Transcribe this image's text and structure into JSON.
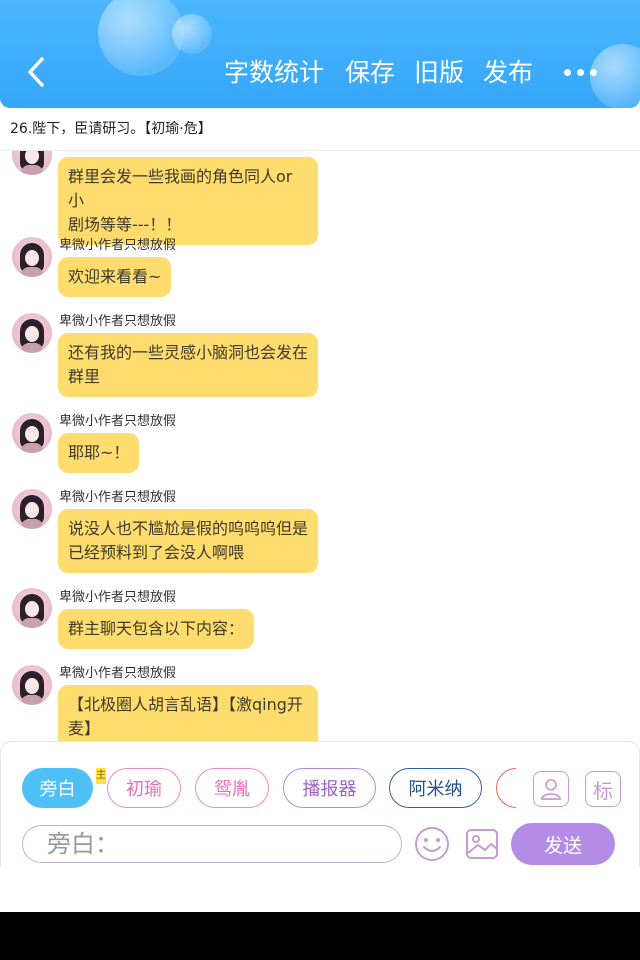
{
  "header": {
    "back_label": "<",
    "actions": [
      "字数统计",
      "保存",
      "旧版",
      "发布"
    ],
    "more_label": "•••",
    "colors": {
      "background": "#3aa9fa",
      "text": "#ffffff"
    }
  },
  "chapter": {
    "title": "26.陛下，臣请研习。【初瑜·危】"
  },
  "messages": [
    {
      "user": "",
      "lines": [
        "群里会发一些我画的角色同人or小",
        "剧场等等---！！"
      ]
    },
    {
      "user": "卑微小作者只想放假",
      "lines": [
        "欢迎来看看~"
      ]
    },
    {
      "user": "卑微小作者只想放假",
      "lines": [
        "还有我的一些灵感小脑洞也会发在",
        "群里"
      ]
    },
    {
      "user": "卑微小作者只想放假",
      "lines": [
        "耶耶~！"
      ]
    },
    {
      "user": "卑微小作者只想放假",
      "lines": [
        "说没人也不尴尬是假的呜呜呜但是",
        "已经预料到了会没人啊喂"
      ]
    },
    {
      "user": "卑微小作者只想放假",
      "lines": [
        "群主聊天包含以下内容："
      ]
    },
    {
      "user": "卑微小作者只想放假",
      "lines": [
        "【北极圈人胡言乱语】【激qing开",
        "麦】"
      ]
    }
  ],
  "composer": {
    "role_chips": [
      "旁白",
      "初瑜",
      "鸳胤",
      "播报器",
      "阿米纳"
    ],
    "chip_badge": "主",
    "side_buttons": {
      "portrait_icon": "portrait-icon",
      "tag_label": "标"
    },
    "input_placeholder": "旁白：",
    "emoji_icon": "emoji-icon",
    "image_icon": "image-icon",
    "send_label": "发送",
    "colors": {
      "narrator_chip": "#4dc0f5",
      "send_button": "#b48ce6",
      "bubble": "#ffdc6e"
    }
  }
}
